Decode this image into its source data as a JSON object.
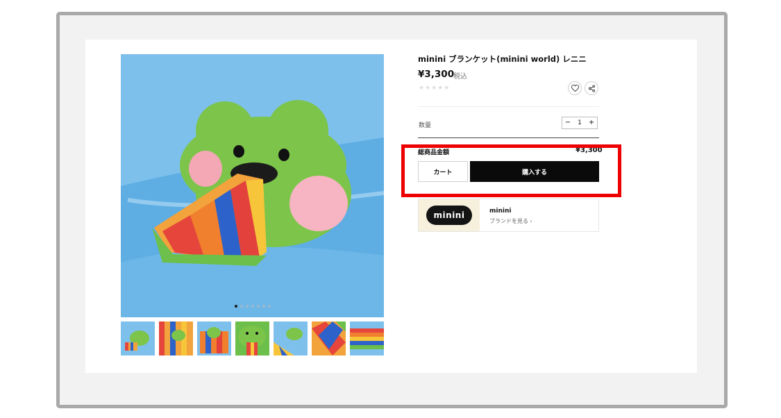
{
  "product": {
    "title": "minini ブランケット(minini world) レニニ",
    "price": "¥3,300",
    "tax_label": "税込",
    "rating_stars": "★★★★★",
    "image_dots_count": 7,
    "active_image_index": 0,
    "thumbnail_count": 7
  },
  "quantity": {
    "label": "数量",
    "minus": "−",
    "value": "1",
    "plus": "+"
  },
  "total": {
    "label": "総商品金額",
    "value": "¥3,300"
  },
  "actions": {
    "cart_label": "カート",
    "buy_label": "購入する"
  },
  "brand": {
    "logo_text": "minini",
    "name": "minini",
    "link_label": "ブランドを見る ›"
  },
  "colors": {
    "highlight": "#ee0000",
    "buy_button": "#0a0a0a",
    "frame_border": "#a9a9a9"
  },
  "icons": [
    "heart-icon",
    "share-icon"
  ]
}
